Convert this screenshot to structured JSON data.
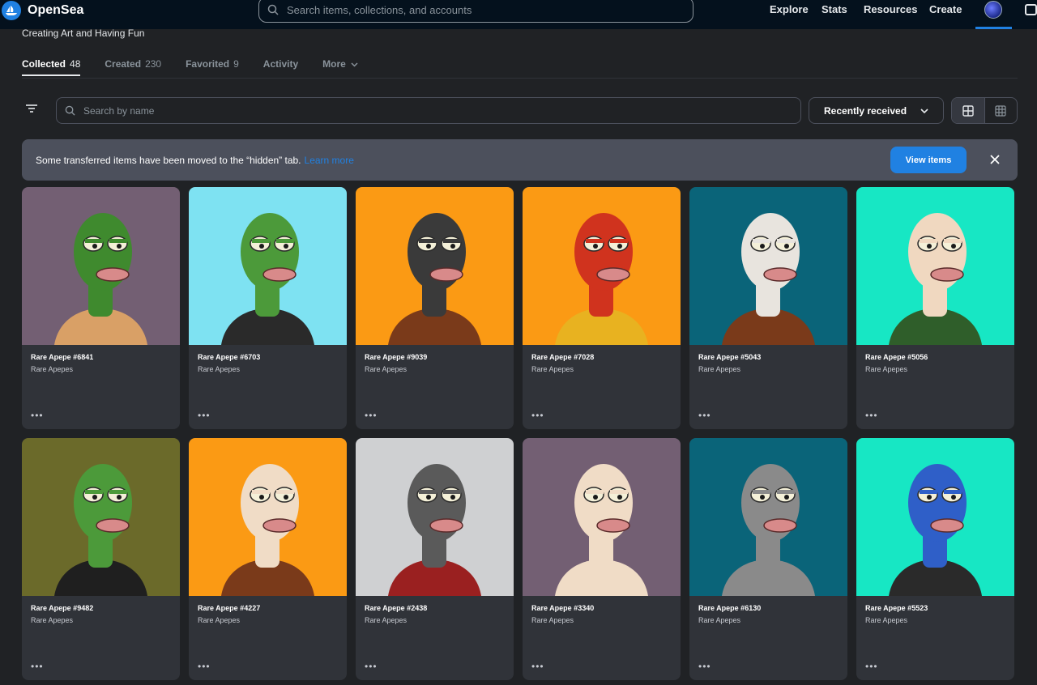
{
  "header": {
    "logo_text": "OpenSea",
    "search_placeholder": "Search items, collections, and accounts",
    "nav": [
      "Explore",
      "Stats",
      "Resources",
      "Create"
    ]
  },
  "profile": {
    "subtitle": "Creating Art and Having Fun"
  },
  "tabs": [
    {
      "label": "Collected",
      "count": "48",
      "active": true
    },
    {
      "label": "Created",
      "count": "230"
    },
    {
      "label": "Favorited",
      "count": "9"
    },
    {
      "label": "Activity",
      "count": ""
    },
    {
      "label": "More",
      "count": ""
    }
  ],
  "toolbar": {
    "search_placeholder": "Search by name",
    "sort_label": "Recently received"
  },
  "banner": {
    "text": "Some transferred items have been moved to the “hidden” tab.",
    "link": "Learn more",
    "button": "View items"
  },
  "colors": {
    "accent": "#2081e2",
    "nav_bg": "#04111d",
    "page_bg": "#202225",
    "card_bg": "#303339"
  },
  "items": [
    {
      "name": "Rare Apepe #6841",
      "collection": "Rare Apepes",
      "bg": "#735f73",
      "skin": "#3f8a2e",
      "shirt": "#d9a066"
    },
    {
      "name": "Rare Apepe #6703",
      "collection": "Rare Apepes",
      "bg": "#7ee2f2",
      "skin": "#4c9a3a",
      "shirt": "#2a2a2a"
    },
    {
      "name": "Rare Apepe #9039",
      "collection": "Rare Apepes",
      "bg": "#fb9a14",
      "skin": "#3a3a3a",
      "shirt": "#7a3a1a"
    },
    {
      "name": "Rare Apepe #7028",
      "collection": "Rare Apepes",
      "bg": "#fb9a14",
      "skin": "#d0331e",
      "shirt": "#e8b220"
    },
    {
      "name": "Rare Apepe #5043",
      "collection": "Rare Apepes",
      "bg": "#0a6479",
      "skin": "#e8e4de",
      "shirt": "#7a3a1a"
    },
    {
      "name": "Rare Apepe #5056",
      "collection": "Rare Apepes",
      "bg": "#17e7c4",
      "skin": "#f0d8c0",
      "shirt": "#2f5e2a"
    },
    {
      "name": "Rare Apepe #9482",
      "collection": "Rare Apepes",
      "bg": "#6b6a2a",
      "skin": "#4c9a3a",
      "shirt": "#1f1f1f"
    },
    {
      "name": "Rare Apepe #4227",
      "collection": "Rare Apepes",
      "bg": "#fb9a14",
      "skin": "#f0dcc6",
      "shirt": "#7a3a1a"
    },
    {
      "name": "Rare Apepe #2438",
      "collection": "Rare Apepes",
      "bg": "#cfd0d2",
      "skin": "#5a5a5a",
      "shirt": "#9a2020"
    },
    {
      "name": "Rare Apepe #3340",
      "collection": "Rare Apepes",
      "bg": "#735f73",
      "skin": "#f0dcc6",
      "shirt": "#f0dcc6"
    },
    {
      "name": "Rare Apepe #6130",
      "collection": "Rare Apepes",
      "bg": "#0a6479",
      "skin": "#8a8a8a",
      "shirt": "#8a8a8a"
    },
    {
      "name": "Rare Apepe #5523",
      "collection": "Rare Apepes",
      "bg": "#17e7c4",
      "skin": "#2f5fc8",
      "shirt": "#2a2a2a"
    }
  ]
}
